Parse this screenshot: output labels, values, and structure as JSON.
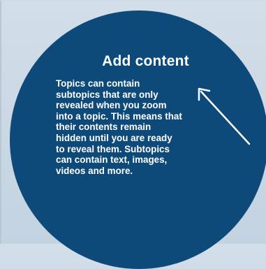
{
  "panel": {
    "title": "Add content",
    "body": "Topics can contain\nsubtopics that are only\nrevealed when you zoom\ninto a topic. This means that\ntheir contents remain\nhidden until you are ready\nto reveal them. Subtopics\ncan contain text, images,\nvideos and more."
  },
  "colors": {
    "background": "#c8d6e3",
    "circle": "#0d4a7a",
    "text": "#ffffff"
  },
  "icons": {
    "pointer": "arrow-pointer-icon"
  }
}
